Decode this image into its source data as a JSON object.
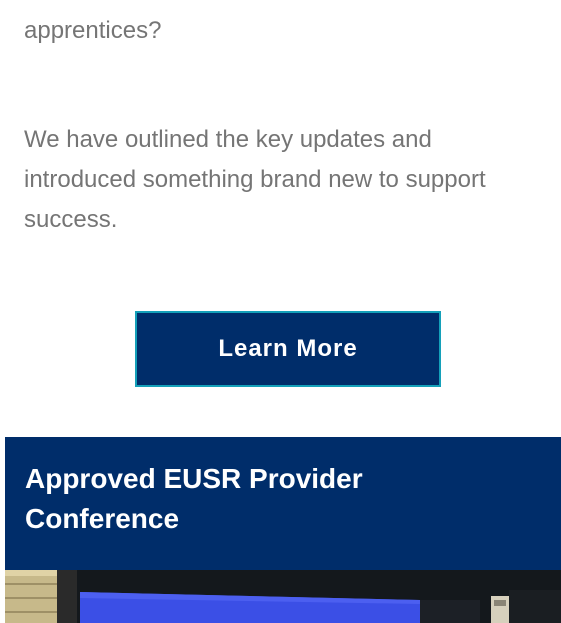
{
  "content": {
    "intro_fragment": "apprentices?",
    "body_text": "We have outlined the key updates and introduced something brand new to support success.",
    "cta_label": "Learn More"
  },
  "section": {
    "title": "Approved EUSR Provider Conference"
  },
  "colors": {
    "brand_navy": "#002d6a",
    "button_border": "#14a0b9",
    "body_text": "#757575"
  },
  "icons": {
    "photo": "conference-photo"
  }
}
